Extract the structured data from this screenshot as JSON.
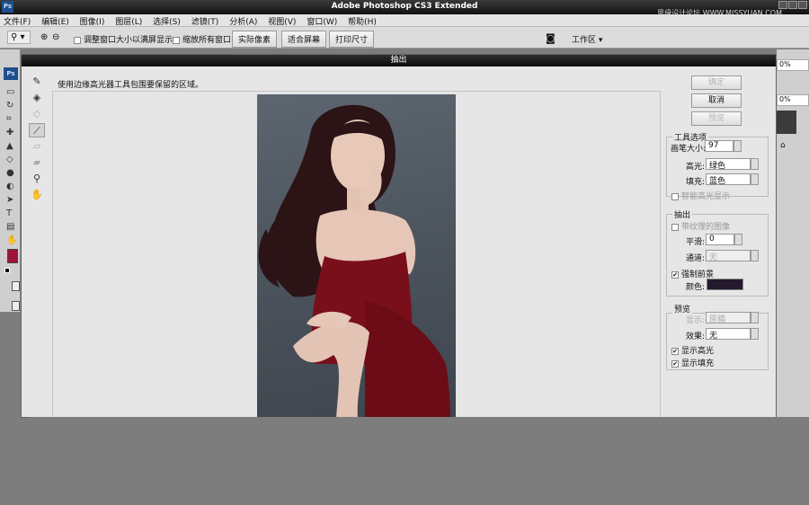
{
  "app": {
    "title": "Adobe Photoshop CS3 Extended",
    "logo": "Ps",
    "watermark": "思缘设计论坛 WWW.MISSYUAN.COM"
  },
  "menu": [
    "文件(F)",
    "编辑(E)",
    "图像(I)",
    "图层(L)",
    "选择(S)",
    "滤镜(T)",
    "分析(A)",
    "视图(V)",
    "窗口(W)",
    "帮助(H)"
  ],
  "options": {
    "resize_label": "调整窗口大小以满屏显示",
    "zoom_all_label": "缩放所有窗口",
    "actual_pixels": "实际像素",
    "fit_screen": "适合屏幕",
    "print_size": "打印尺寸",
    "workspace": "工作区"
  },
  "right_panel": {
    "pct1": "0%",
    "pct2": "0%"
  },
  "dialog": {
    "title": "抽出",
    "instruction": "使用边缘高光器工具包围要保留的区域。",
    "ok": "确定",
    "cancel": "取消",
    "preview_btn": "预览",
    "tool_options": {
      "title": "工具选项",
      "brush_size_label": "画笔大小:",
      "brush_size": "97",
      "highlight_label": "高光:",
      "highlight_value": "绿色",
      "fill_label": "填充:",
      "fill_value": "蓝色",
      "smart_highlight": "智能高光显示"
    },
    "extraction": {
      "title": "抽出",
      "textured": "带纹理的图像",
      "smooth_label": "平滑:",
      "smooth_value": "0",
      "channel_label": "通道:",
      "channel_value": "无",
      "force_fg": "强制前景",
      "color_label": "颜色:",
      "force_color": "#241a2e"
    },
    "preview": {
      "title": "预览",
      "show_label": "显示:",
      "show_value": "原稿",
      "effect_label": "效果:",
      "effect_value": "无",
      "show_highlight": "显示高光",
      "show_fill": "显示填充"
    }
  },
  "colors": {
    "foreground": "#a0123a",
    "dress": "#7a0f1c",
    "hair": "#2b1316"
  }
}
